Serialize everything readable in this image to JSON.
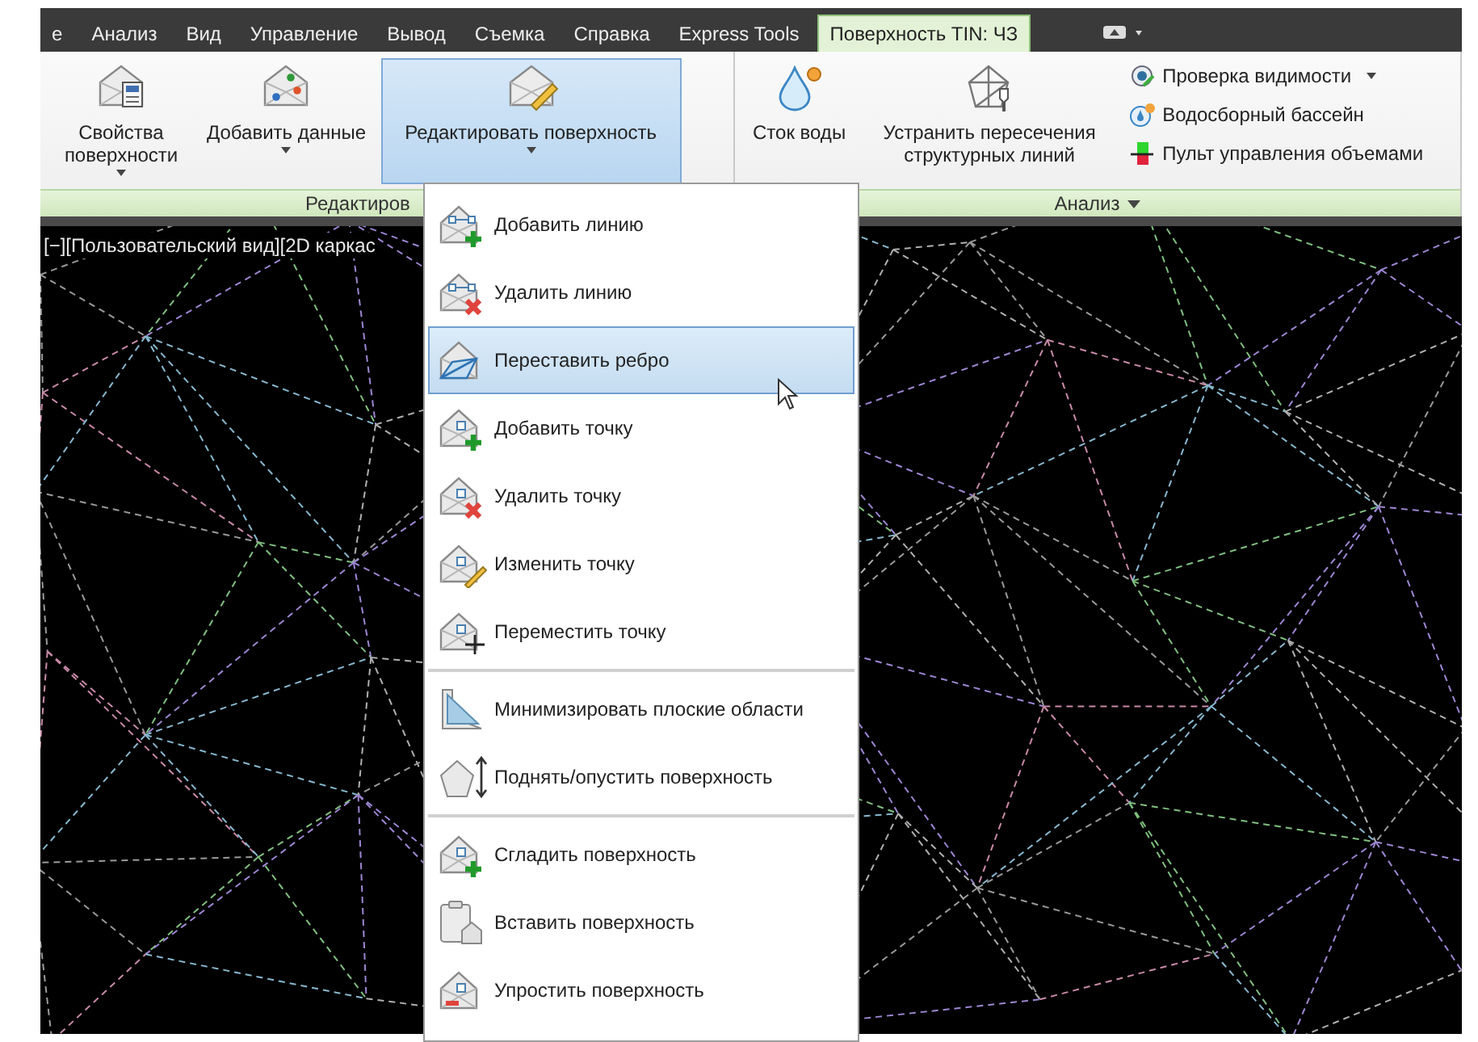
{
  "tabs": [
    {
      "label": "е",
      "selected": false
    },
    {
      "label": "Анализ",
      "selected": false
    },
    {
      "label": "Вид",
      "selected": false
    },
    {
      "label": "Управление",
      "selected": false
    },
    {
      "label": "Вывод",
      "selected": false
    },
    {
      "label": "Съемка",
      "selected": false
    },
    {
      "label": "Справка",
      "selected": false
    },
    {
      "label": "Express Tools",
      "selected": false
    },
    {
      "label": "Поверхность TIN: ЧЗ",
      "selected": true
    }
  ],
  "ribbon": {
    "panels": [
      {
        "title": "Редактиров",
        "expandable": false,
        "large_buttons": [
          {
            "label": "Свойства поверхности",
            "dropdown": true,
            "selected": false
          },
          {
            "label": "Добавить данные",
            "dropdown": true,
            "selected": false
          },
          {
            "label": "Редактировать поверхность",
            "dropdown": true,
            "selected": true
          }
        ]
      },
      {
        "title": "Анализ",
        "expandable": true,
        "large_buttons": [
          {
            "label": "Сток воды",
            "dropdown": false,
            "selected": false
          },
          {
            "label": "Устранить пересечения структурных линий",
            "dropdown": false,
            "selected": false
          }
        ],
        "small_buttons": [
          {
            "label": "Проверка видимости",
            "dropdown": true
          },
          {
            "label": "Водосборный бассейн",
            "dropdown": false
          },
          {
            "label": "Пульт управления объемами",
            "dropdown": false
          }
        ]
      }
    ]
  },
  "viewport": {
    "label": "[−][Пользовательский вид][2D каркас"
  },
  "menu": {
    "groups": [
      {
        "items": [
          {
            "label": "Добавить линию",
            "selected": false
          },
          {
            "label": "Удалить линию",
            "selected": false
          },
          {
            "label": "Переставить ребро",
            "selected": true
          },
          {
            "label": "Добавить точку",
            "selected": false
          },
          {
            "label": "Удалить точку",
            "selected": false
          },
          {
            "label": "Изменить точку",
            "selected": false
          },
          {
            "label": "Переместить точку",
            "selected": false
          }
        ]
      },
      {
        "items": [
          {
            "label": "Минимизировать плоские области",
            "selected": false
          },
          {
            "label": "Поднять/опустить поверхность",
            "selected": false
          }
        ]
      },
      {
        "items": [
          {
            "label": "Сгладить поверхность",
            "selected": false
          },
          {
            "label": "Вставить поверхность",
            "selected": false
          },
          {
            "label": "Упростить поверхность",
            "selected": false
          }
        ]
      }
    ]
  }
}
